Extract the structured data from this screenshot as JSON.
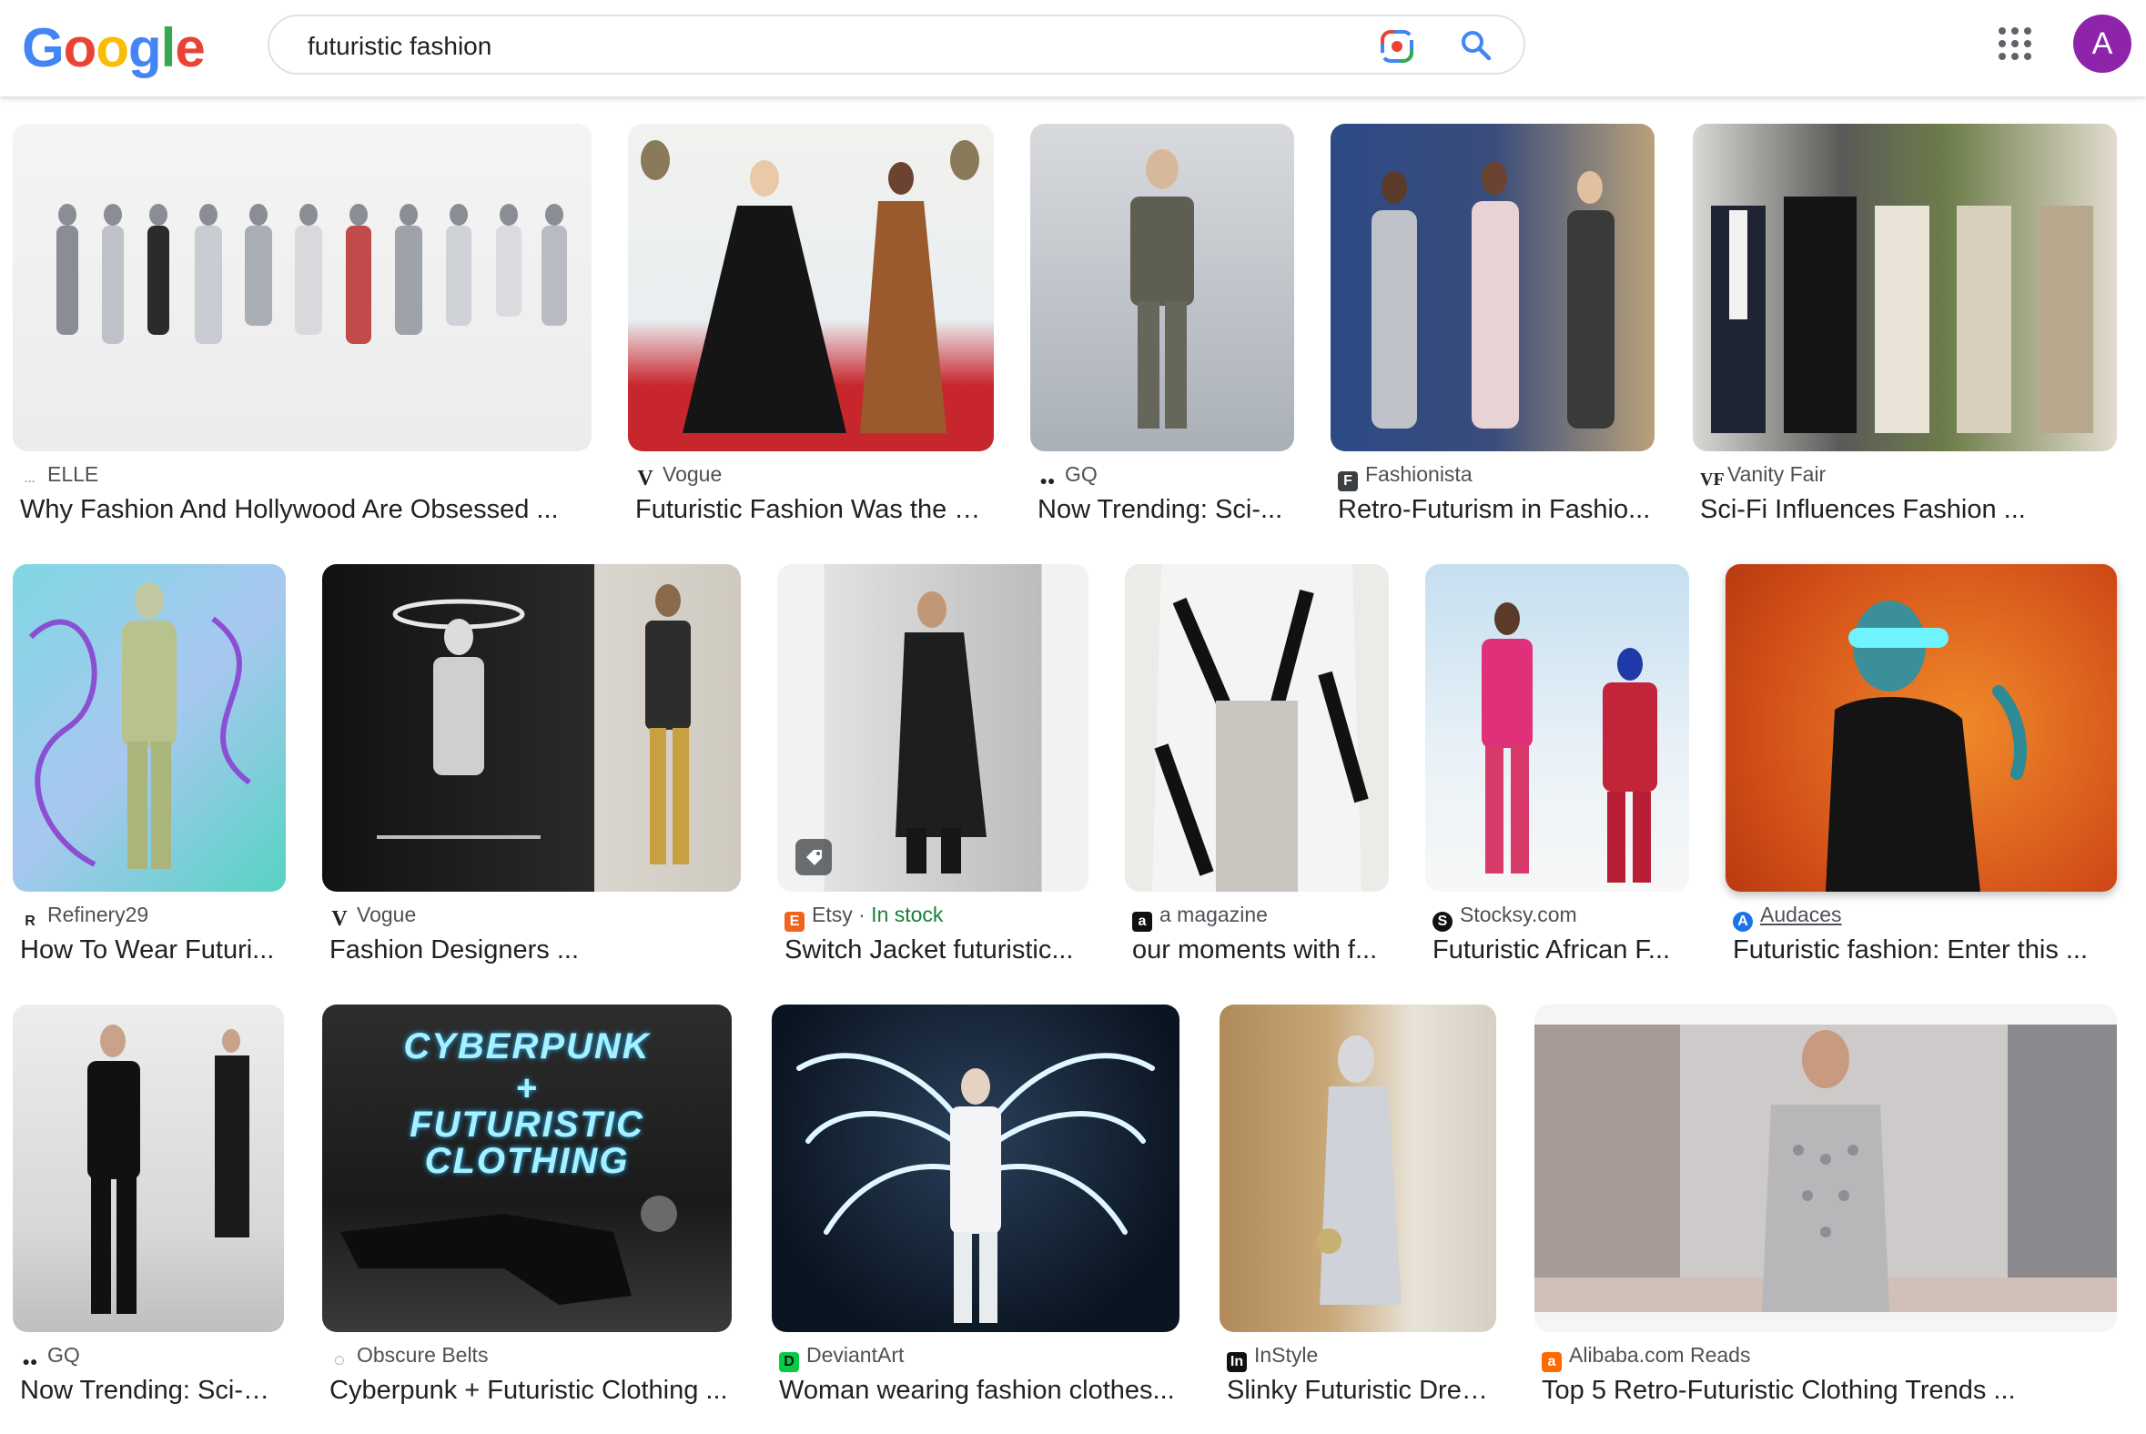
{
  "logo": {
    "letters": [
      "G",
      "o",
      "o",
      "g",
      "l",
      "e"
    ],
    "colors": [
      "#4285f4",
      "#ea4335",
      "#fbbc05",
      "#4285f4",
      "#34a853",
      "#ea4335"
    ]
  },
  "search": {
    "query": "futuristic fashion"
  },
  "avatar": {
    "letter": "A",
    "color": "#8e24aa"
  },
  "results": [
    {
      "source": "ELLE",
      "title": "Why Fashion And Hollywood Are Obsessed ..."
    },
    {
      "source": "Vogue",
      "title": "Futuristic Fashion Was the B..."
    },
    {
      "source": "GQ",
      "title": "Now Trending: Sci-..."
    },
    {
      "source": "Fashionista",
      "title": "Retro-Futurism in Fashio..."
    },
    {
      "source": "Vanity Fair",
      "title": "Sci-Fi Influences Fashion ..."
    },
    {
      "source": "Refinery29",
      "title": "How To Wear Futuri..."
    },
    {
      "source": "Vogue",
      "title": "Fashion Designers ..."
    },
    {
      "source": "Etsy",
      "stock": "· In stock",
      "title": "Switch Jacket futuristic..."
    },
    {
      "source": "a magazine",
      "title": "our moments with f..."
    },
    {
      "source": "Stocksy.com",
      "title": "Futuristic African F..."
    },
    {
      "source": "Audaces",
      "title": "Futuristic fashion: Enter this ..."
    },
    {
      "source": "GQ",
      "title": "Now Trending: Sci-Fi..."
    },
    {
      "source": "Obscure Belts",
      "title": "Cyberpunk + Futuristic Clothing ..."
    },
    {
      "source": "DeviantArt",
      "title": "Woman wearing fashion clothes..."
    },
    {
      "source": "InStyle",
      "title": "Slinky Futuristic Dres..."
    },
    {
      "source": "Alibaba.com Reads",
      "title": "Top 5 Retro-Futuristic Clothing Trends ..."
    }
  ],
  "poster": {
    "line1": "CYBERPUNK",
    "line2": "+",
    "line3": "FUTURISTIC",
    "line4": "CLOTHING"
  }
}
